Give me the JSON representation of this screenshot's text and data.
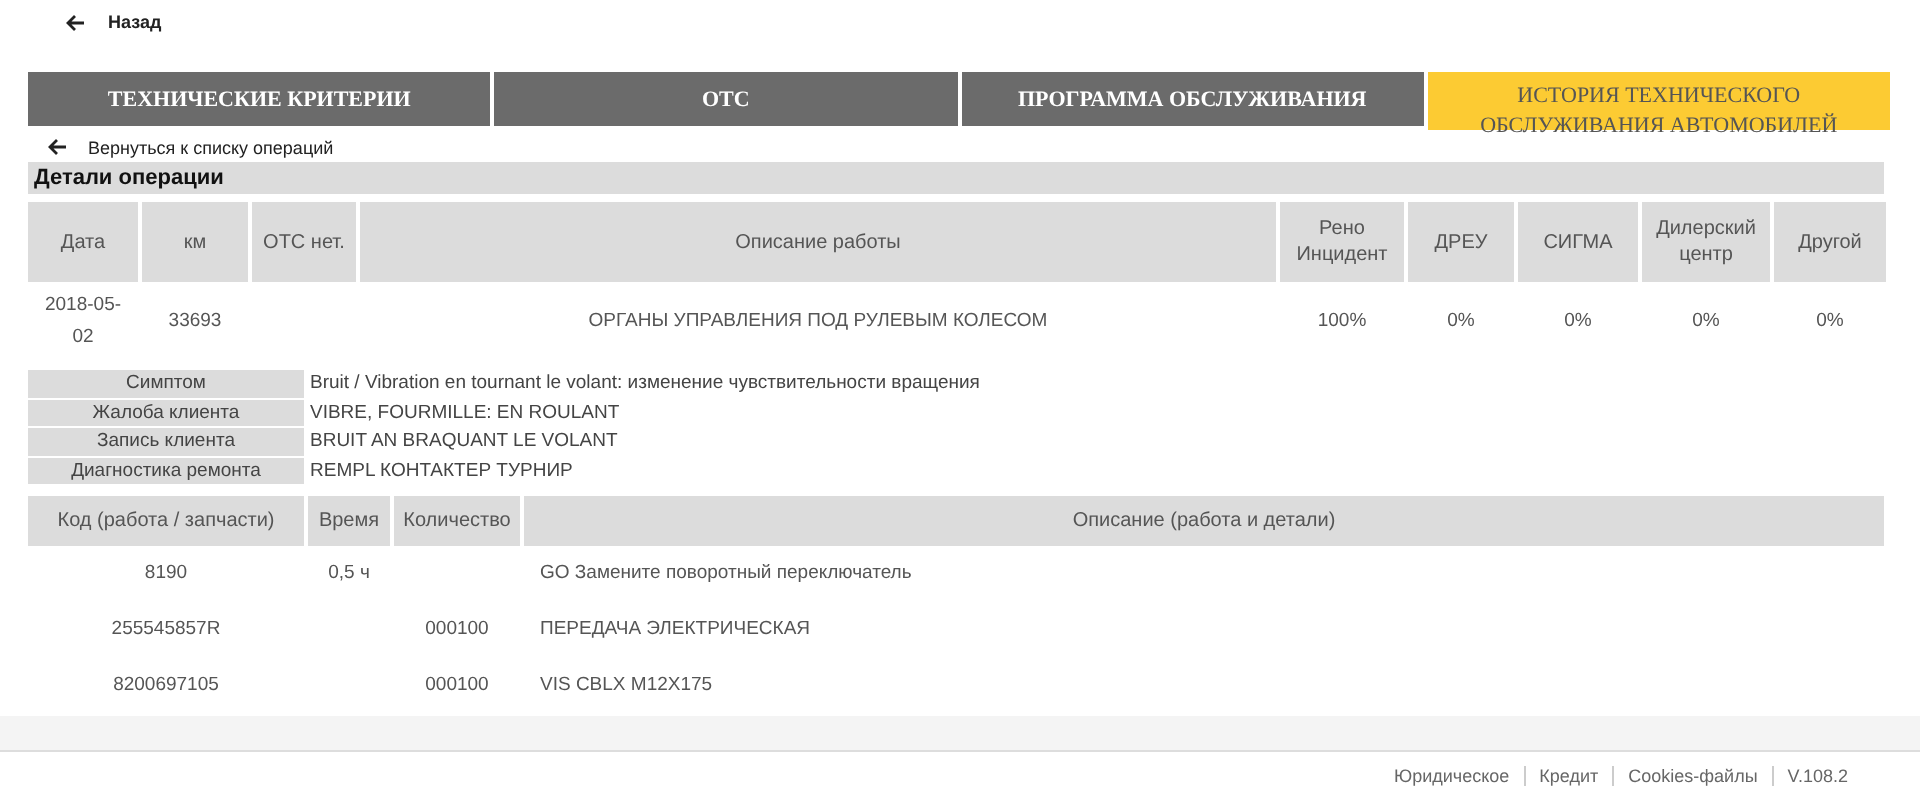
{
  "back_link": "Назад",
  "tabs": [
    {
      "label": "ТЕХНИЧЕСКИЕ КРИТЕРИИ",
      "selected": false
    },
    {
      "label": "ОТС",
      "selected": false
    },
    {
      "label": "ПРОГРАММА ОБСЛУЖИВАНИЯ",
      "selected": false
    },
    {
      "label": "ИСТОРИЯ ТЕХНИЧЕСКОГО ОБСЛУЖИВАНИЯ АВТОМОБИЛЕЙ",
      "selected": true
    }
  ],
  "return_link": "Вернуться к списку операций",
  "section_title": "Детали операции",
  "operation_table": {
    "columns": [
      "Дата",
      "км",
      "ОТС нет.",
      "Описание работы",
      "Рено Инцидент",
      "ДРЕУ",
      "СИГМА",
      "Дилерский центр",
      "Другой"
    ],
    "rows": [
      [
        "2018-05-02",
        "33693",
        "",
        "ОРГАНЫ УПРАВЛЕНИЯ ПОД РУЛЕВЫМ КОЛЕСОМ",
        "100%",
        "0%",
        "0%",
        "0%",
        "0%"
      ]
    ]
  },
  "details": [
    {
      "label": "Симптом",
      "value": "Bruit / Vibration en tournant le volant: изменение чувствительности вращения"
    },
    {
      "label": "Жалоба клиента",
      "value": "VIBRE, FOURMILLE: EN ROULANT"
    },
    {
      "label": "Запись клиента",
      "value": "BRUIT AN BRAQUANT LE VOLANT"
    },
    {
      "label": "Диагностика ремонта",
      "value": "REMPL КОНТАКТЕР ТУРНИР"
    }
  ],
  "parts_table": {
    "columns": [
      "Код (работа / запчасти)",
      "Время",
      "Количество",
      "Описание (работа и детали)"
    ],
    "rows": [
      [
        "8190",
        "0,5 ч",
        "",
        "GO Замените поворотный переключатель"
      ],
      [
        "255545857R",
        "",
        "000100",
        "ПЕРЕДАЧА ЭЛЕКТРИЧЕСКАЯ"
      ],
      [
        "8200697105",
        "",
        "000100",
        "VIS CBLX M12X175"
      ]
    ]
  },
  "footer_links": [
    "Юридическое",
    "Кредит",
    "Cookies-файлы",
    "V.108.2"
  ]
}
